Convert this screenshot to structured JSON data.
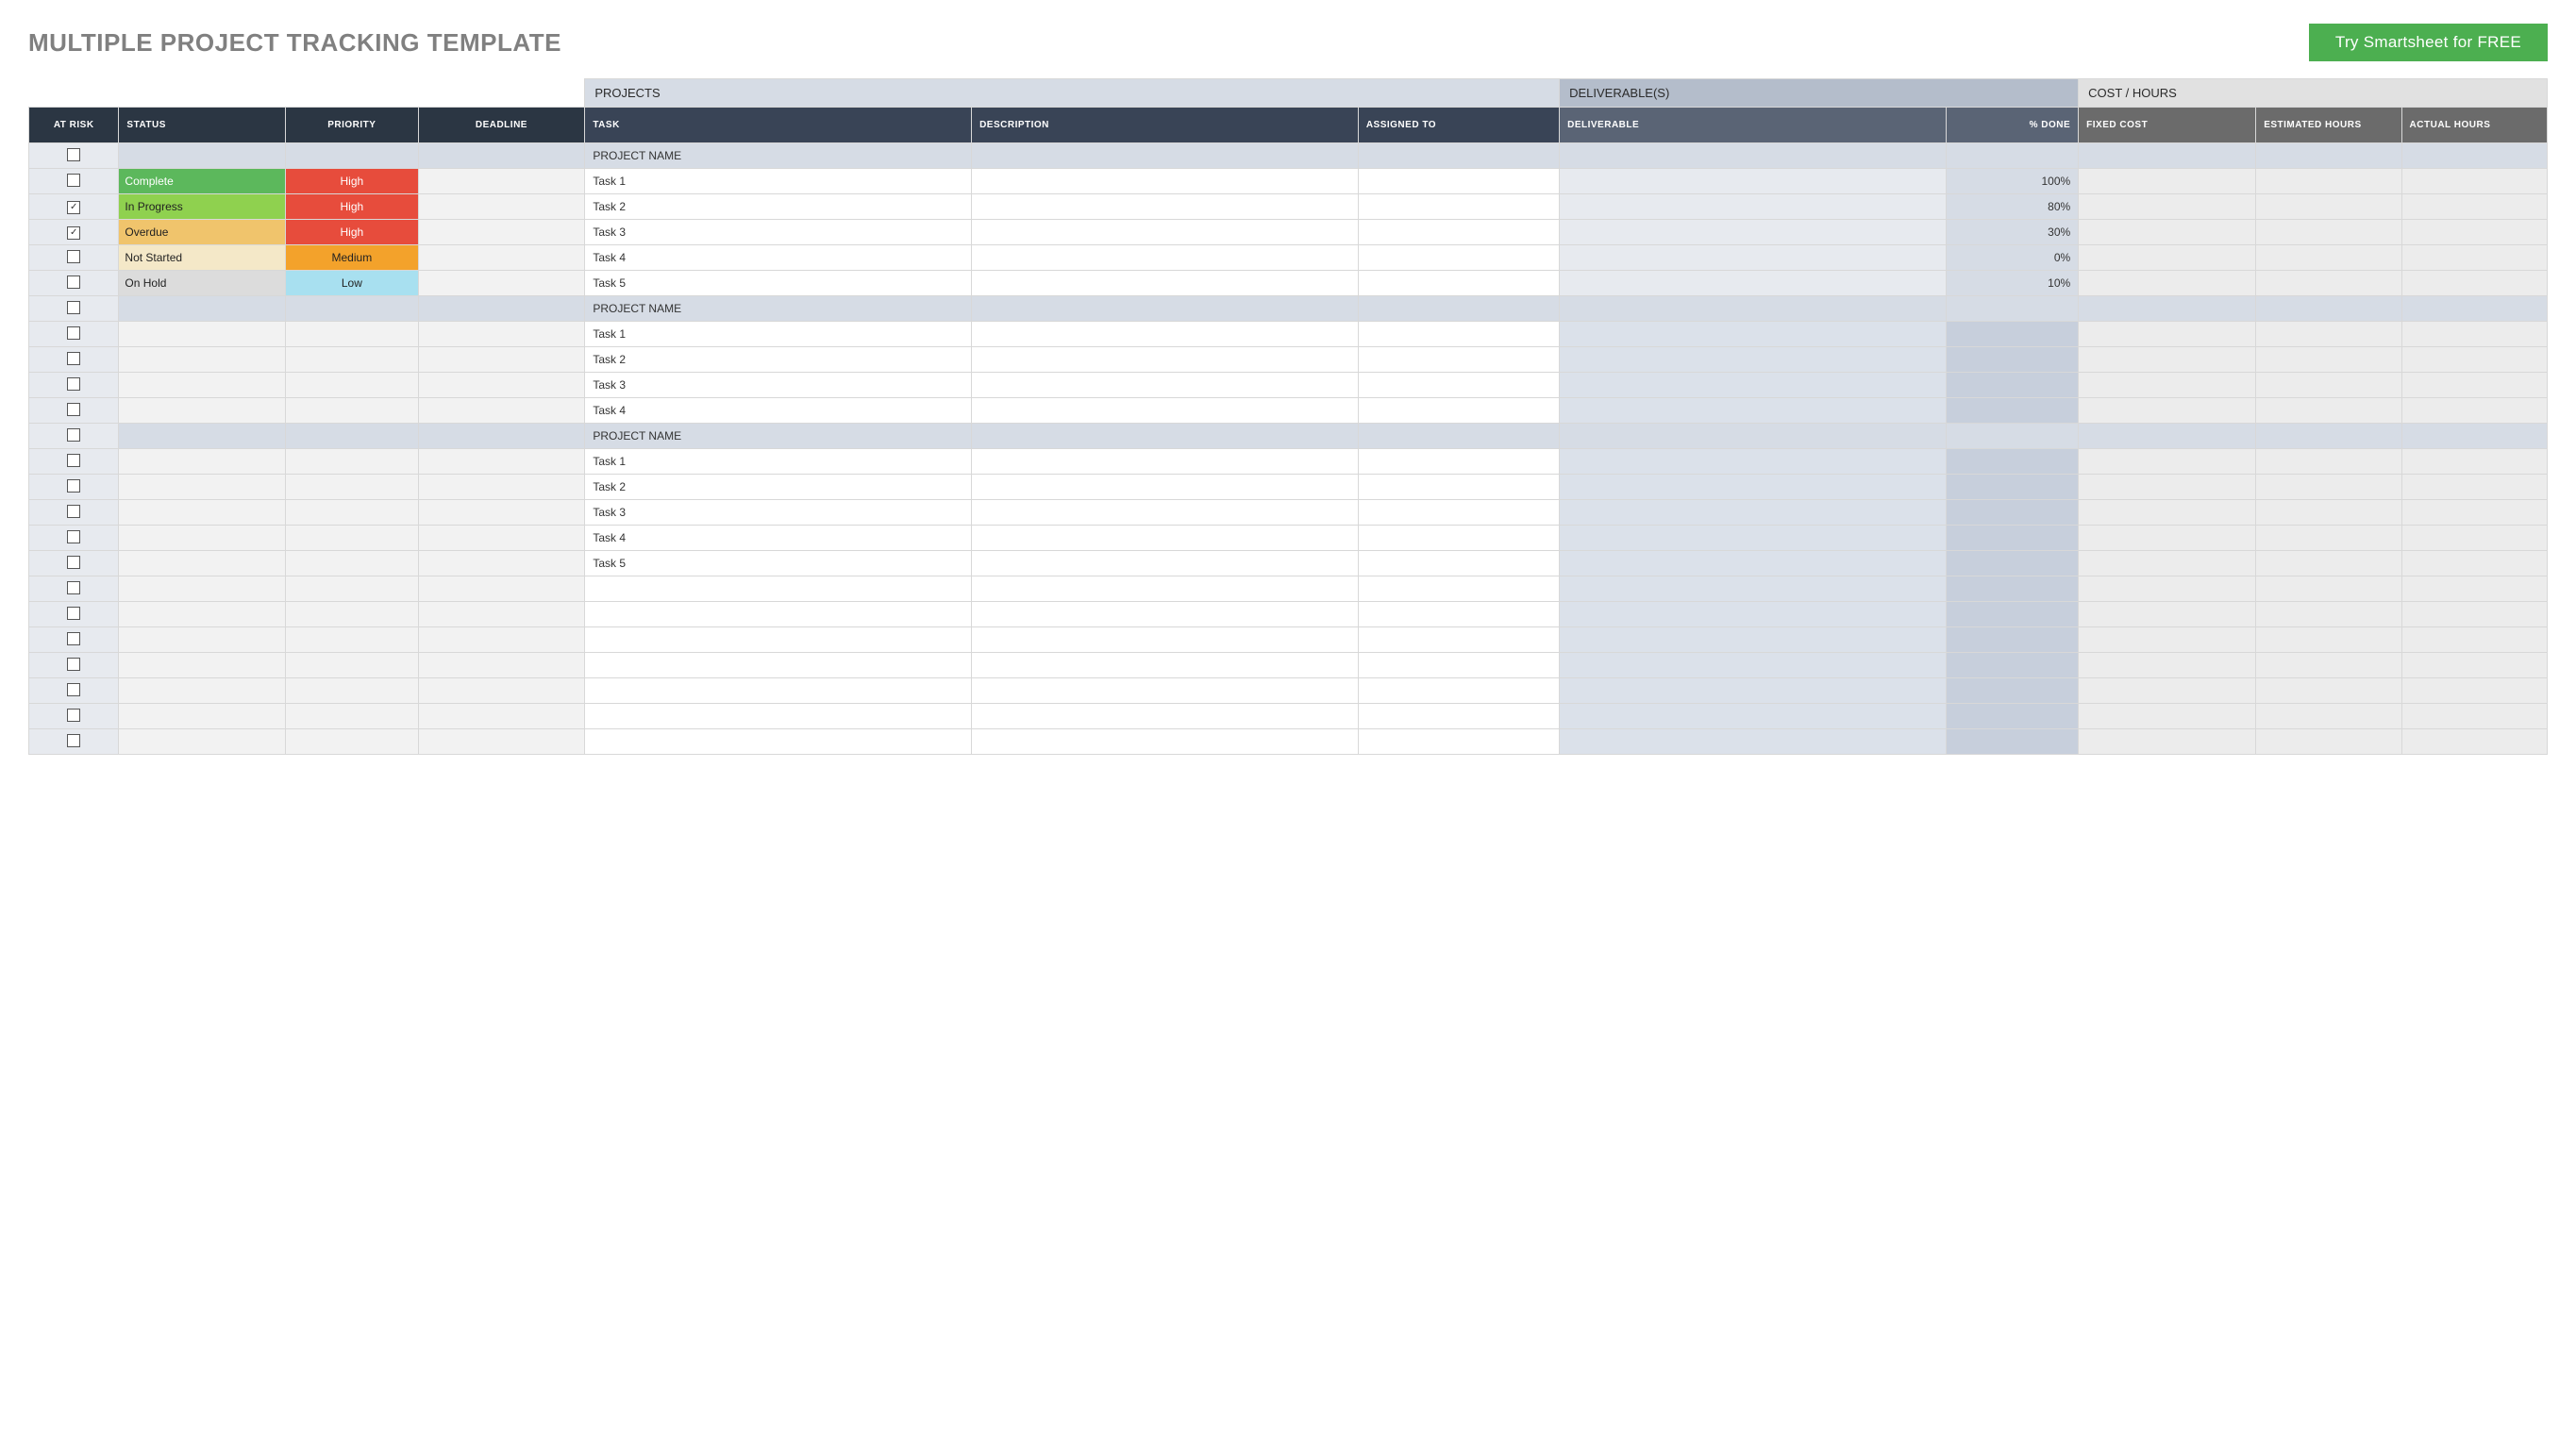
{
  "header": {
    "title": "MULTIPLE PROJECT TRACKING TEMPLATE",
    "cta": "Try Smartsheet for FREE"
  },
  "groups": {
    "projects": "PROJECTS",
    "deliverables": "DELIVERABLE(S)",
    "cost": "COST / HOURS"
  },
  "columns": {
    "at_risk": "AT RISK",
    "status": "STATUS",
    "priority": "PRIORITY",
    "deadline": "DEADLINE",
    "task": "TASK",
    "description": "DESCRIPTION",
    "assigned_to": "ASSIGNED TO",
    "deliverable": "DELIVERABLE",
    "pct_done": "% DONE",
    "fixed_cost": "FIXED COST",
    "est_hours": "ESTIMATED HOURS",
    "act_hours": "ACTUAL HOURS"
  },
  "status_labels": {
    "complete": "Complete",
    "in_progress": "In Progress",
    "overdue": "Overdue",
    "not_started": "Not Started",
    "on_hold": "On Hold"
  },
  "priority_labels": {
    "high": "High",
    "medium": "Medium",
    "low": "Low"
  },
  "sections": [
    {
      "project_label": "PROJECT NAME",
      "rows": [
        {
          "at_risk": false,
          "status": "complete",
          "priority": "high",
          "task": "Task 1",
          "pct_done": "100%"
        },
        {
          "at_risk": true,
          "status": "in_progress",
          "priority": "high",
          "task": "Task 2",
          "pct_done": "80%"
        },
        {
          "at_risk": true,
          "status": "overdue",
          "priority": "high",
          "task": "Task 3",
          "pct_done": "30%"
        },
        {
          "at_risk": false,
          "status": "not_started",
          "priority": "medium",
          "task": "Task 4",
          "pct_done": "0%"
        },
        {
          "at_risk": false,
          "status": "on_hold",
          "priority": "low",
          "task": "Task 5",
          "pct_done": "10%"
        }
      ]
    },
    {
      "project_label": "PROJECT NAME",
      "rows": [
        {
          "task": "Task 1"
        },
        {
          "task": "Task 2"
        },
        {
          "task": "Task 3"
        },
        {
          "task": "Task 4"
        }
      ]
    },
    {
      "project_label": "PROJECT NAME",
      "rows": [
        {
          "task": "Task 1"
        },
        {
          "task": "Task 2"
        },
        {
          "task": "Task 3"
        },
        {
          "task": "Task 4"
        },
        {
          "task": "Task 5"
        }
      ]
    }
  ],
  "trailing_blank_rows": 7
}
